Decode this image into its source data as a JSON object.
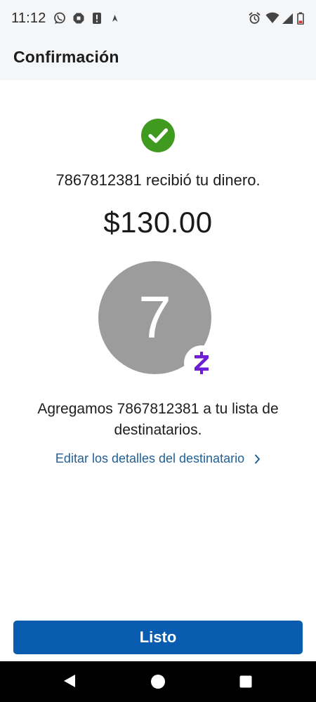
{
  "status_bar": {
    "time": "11:12",
    "left_icons": [
      "whatsapp-icon",
      "chase-icon",
      "alert-icon",
      "location-arrow-icon"
    ],
    "right_icons": [
      "alarm-icon",
      "wifi-icon",
      "cell-signal-icon",
      "battery-icon"
    ]
  },
  "header": {
    "title": "Confirmación"
  },
  "confirmation": {
    "status_icon": "check-circle-icon",
    "status_color": "#3f9a1f",
    "message": "7867812381 recibió tu dinero.",
    "amount": "$130.00",
    "avatar_initial": "7",
    "avatar_color": "#9c9c9c",
    "badge_icon": "zelle-icon",
    "badge_color": "#6d1ed4",
    "added_message": "Agregamos 7867812381 a tu lista de destinatarios.",
    "edit_link": "Editar los detalles del destinatario"
  },
  "actions": {
    "done_label": "Listo",
    "done_color": "#0a5cb1"
  },
  "nav_bar": {
    "items": [
      "back-icon",
      "home-icon",
      "recents-icon"
    ]
  }
}
